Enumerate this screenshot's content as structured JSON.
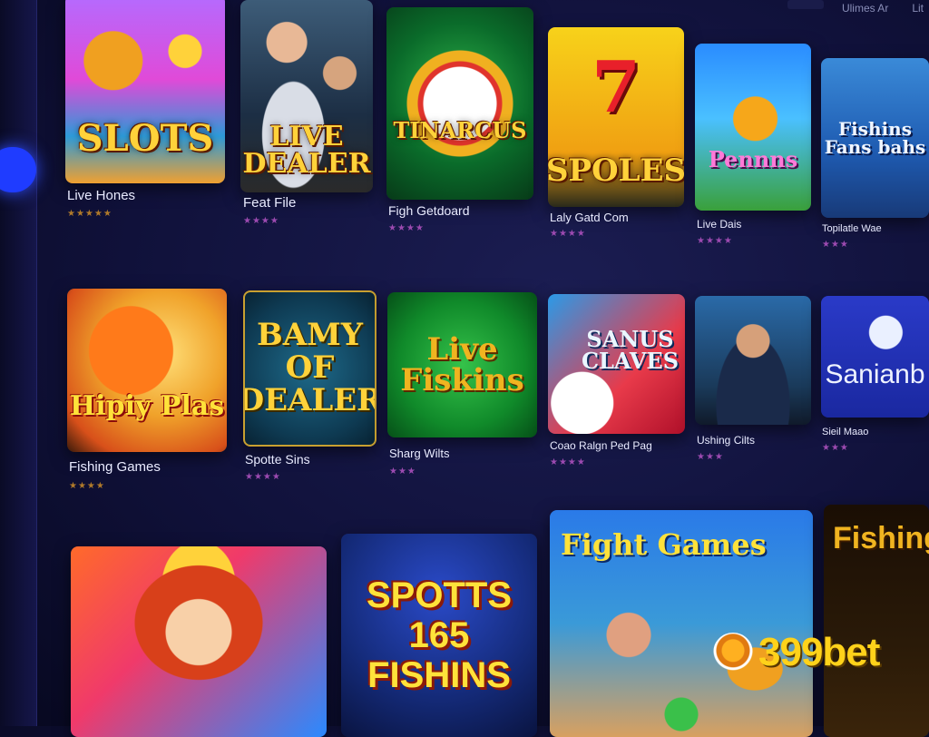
{
  "top_links": [
    "Ulimes Ar",
    "Lit"
  ],
  "rows": [
    [
      {
        "title": "SLOTS",
        "name": "Live Hones",
        "stars": "★★★★★"
      },
      {
        "title": "LIVE\nDEALER",
        "name": "Feat File",
        "stars": "★★★★"
      },
      {
        "title": "TINARCUS",
        "name": "Figh Getdoard",
        "stars": "★★★★"
      },
      {
        "title": "SPOLES",
        "badge": "7",
        "name": "Laly Gatd Com",
        "stars": "★★★★"
      },
      {
        "title": "Pennns",
        "name": "Live Dais",
        "stars": "★★★★"
      },
      {
        "title": "Fishins\nFans bahs",
        "name": "Topilatle Wae",
        "stars": "★★★"
      }
    ],
    [
      {
        "title": "Hipiy Plas",
        "name": "Fishing Games",
        "stars": "★★★★"
      },
      {
        "title": "BAMY\nOF\nDEALER",
        "name": "Spotte Sins",
        "stars": "★★★★"
      },
      {
        "title": "Live\nFiskins",
        "name": "Sharg Wilts",
        "stars": "★★★"
      },
      {
        "title": "SANUS\nCLAVES",
        "name": "Coao Ralgn Ped Pag",
        "stars": "★★★★"
      },
      {
        "title": "",
        "name": "Ushing Cilts",
        "stars": "★★★"
      },
      {
        "title": "Sanianb",
        "name": "Sieil Maao",
        "stars": "★★★"
      }
    ],
    [
      {
        "title": "",
        "name": ""
      },
      {
        "title": "SPOTTS\n165\nFISHINS",
        "name": ""
      },
      {
        "title": "Fight Games",
        "name": ""
      },
      {
        "title": "Fishing",
        "name": ""
      }
    ]
  ],
  "brand": {
    "logo": "399bet"
  },
  "colors": {
    "accent": "#1f3cff",
    "gold": "#ffd23a",
    "bg": "#10113a"
  }
}
